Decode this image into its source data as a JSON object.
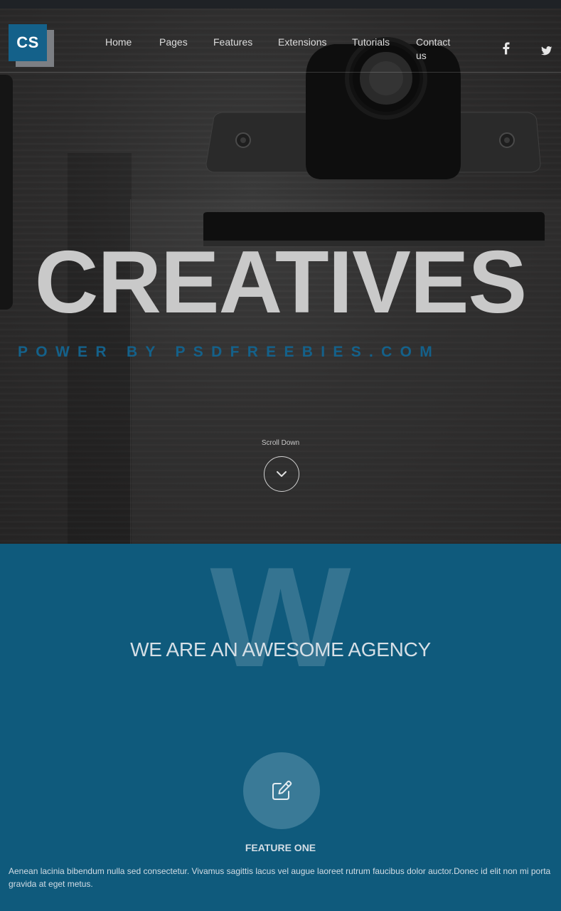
{
  "brand": {
    "logo_text": "CS",
    "accent_color": "#14618a"
  },
  "nav": {
    "items": [
      {
        "label": "Home"
      },
      {
        "label": "Pages"
      },
      {
        "label": "Features"
      },
      {
        "label": "Extensions"
      },
      {
        "label": "Tutorials"
      },
      {
        "label": "Contact us"
      }
    ]
  },
  "social": {
    "facebook_icon": "f",
    "twitter_icon": "twitter-bird"
  },
  "hero": {
    "title": "CREATIVES",
    "subtitle": "POWER BY PSDFREEBIES.COM",
    "scroll_label": "Scroll Down"
  },
  "about": {
    "big_letter": "W",
    "title": "WE ARE AN AWESOME AGENCY",
    "bg_color": "#0f5a7c"
  },
  "feature": {
    "icon": "edit-icon",
    "title": "FEATURE ONE",
    "text": "Aenean lacinia bibendum nulla sed consectetur. Vivamus sagittis lacus vel augue laoreet rutrum faucibus dolor auctor.Donec id elit non mi porta gravida at eget metus."
  }
}
